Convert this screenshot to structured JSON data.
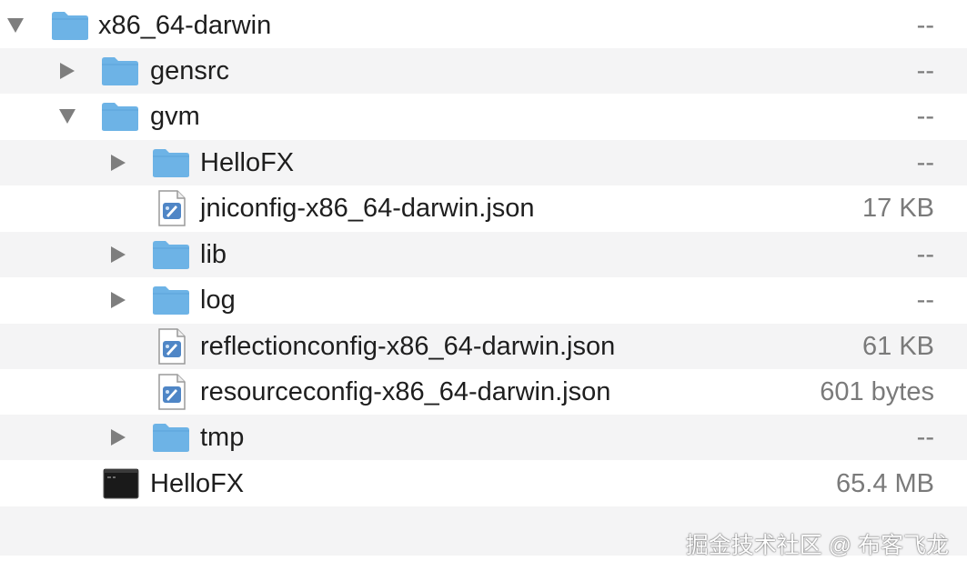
{
  "rows": [
    {
      "name": "x86_64-darwin",
      "size": "--",
      "kind": "folder",
      "expanded": true,
      "level": 0
    },
    {
      "name": "gensrc",
      "size": "--",
      "kind": "folder",
      "expanded": false,
      "level": 1
    },
    {
      "name": "gvm",
      "size": "--",
      "kind": "folder",
      "expanded": true,
      "level": 1
    },
    {
      "name": "HelloFX",
      "size": "--",
      "kind": "folder",
      "expanded": false,
      "level": 2
    },
    {
      "name": "jniconfig-x86_64-darwin.json",
      "size": "17 KB",
      "kind": "json-file",
      "level": 2
    },
    {
      "name": "lib",
      "size": "--",
      "kind": "folder",
      "expanded": false,
      "level": 2
    },
    {
      "name": "log",
      "size": "--",
      "kind": "folder",
      "expanded": false,
      "level": 2
    },
    {
      "name": "reflectionconfig-x86_64-darwin.json",
      "size": "61 KB",
      "kind": "json-file",
      "level": 2
    },
    {
      "name": "resourceconfig-x86_64-darwin.json",
      "size": "601 bytes",
      "kind": "json-file",
      "level": 2
    },
    {
      "name": "tmp",
      "size": "--",
      "kind": "folder",
      "expanded": false,
      "level": 2
    },
    {
      "name": "HelloFX",
      "size": "65.4 MB",
      "kind": "executable",
      "level": 1
    }
  ],
  "watermark": "掘金技术社区 @ 布客飞龙",
  "colors": {
    "folder": "#6db3e6",
    "folder_tab": "#5aa3da",
    "stripe": "#f4f4f5",
    "size_text": "#7a7a7a"
  }
}
